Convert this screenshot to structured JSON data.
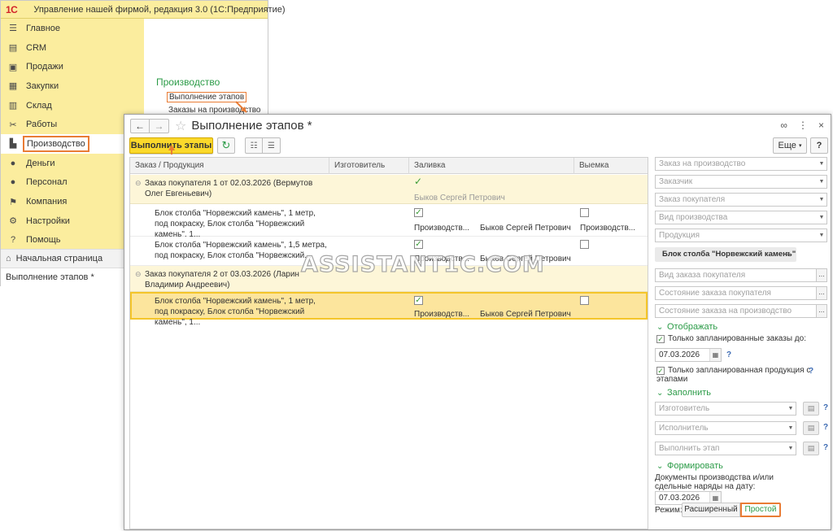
{
  "app": {
    "logo": "1С",
    "title": "Управление нашей фирмой, редакция 3.0  (1С:Предприятие)"
  },
  "sidebar": {
    "items": [
      {
        "label": "Главное",
        "icon": "menu-icon"
      },
      {
        "label": "CRM",
        "icon": "crm-icon"
      },
      {
        "label": "Продажи",
        "icon": "sales-icon"
      },
      {
        "label": "Закупки",
        "icon": "purchases-icon"
      },
      {
        "label": "Склад",
        "icon": "warehouse-icon"
      },
      {
        "label": "Работы",
        "icon": "works-icon"
      },
      {
        "label": "Производство",
        "icon": "factory-icon"
      },
      {
        "label": "Деньги",
        "icon": "money-icon"
      },
      {
        "label": "Персонал",
        "icon": "people-icon"
      },
      {
        "label": "Компания",
        "icon": "flag-icon"
      },
      {
        "label": "Настройки",
        "icon": "gear-icon"
      },
      {
        "label": "Помощь",
        "icon": "help-icon"
      }
    ],
    "active": "Производство"
  },
  "section": {
    "title": "Производство",
    "links": [
      "Выполнение этапов",
      "Заказы на производство"
    ]
  },
  "bottom": {
    "home": "Начальная страница",
    "open_window": "Выполнение этапов *"
  },
  "dialog": {
    "title": "Выполнение этапов *",
    "run_button": "Выполнить этапы",
    "more_button": "Еще",
    "help_button": "?"
  },
  "table": {
    "columns": [
      "Заказ / Продукция",
      "Изготовитель",
      "Заливка",
      "Выемка"
    ],
    "groups": [
      {
        "title": "Заказ покупателя 1 от 02.03.2026  (Вермутов Олег Евгеньевич)",
        "fill_done": true,
        "fill_performer": "Быков Сергей Петрович",
        "rows": [
          {
            "product": "Блок столба \"Норвежский камень\", 1 метр, под покраску, Блок столба \"Норвежский камень\", 1...",
            "fill_checked": true,
            "fill_maker": "Производств...",
            "fill_performer": "Быков Сергей Петрович",
            "cut_checked": false,
            "cut_maker": "Производств..."
          },
          {
            "product": "Блок столба \"Норвежский камень\", 1,5 метра, под покраску, Блок столба \"Норвежский...",
            "fill_checked": true,
            "fill_maker": "Производств...",
            "fill_performer": "Быков Сергей Петрович",
            "cut_checked": false,
            "cut_maker": ""
          }
        ]
      },
      {
        "title": "Заказ покупателя 2 от 03.03.2026  (Ларин Владимир Андреевич)",
        "rows": [
          {
            "product": "Блок столба \"Норвежский камень\", 1 метр, под покраску, Блок столба \"Норвежский камень\", 1...",
            "fill_checked": true,
            "fill_maker": "Производств...",
            "fill_performer": "Быков Сергей Петрович",
            "cut_checked": false,
            "cut_maker": ""
          }
        ]
      }
    ]
  },
  "filters": {
    "placeholders": [
      "Заказ на производство",
      "Заказчик",
      "Заказ покупателя",
      "Вид производства",
      "Продукция"
    ],
    "product_tag": "Блок столба \"Норвежский камень\"",
    "placeholders2": [
      "Вид заказа покупателя",
      "Состояние заказа покупателя",
      "Состояние заказа на производство"
    ],
    "display_section": "Отображать",
    "only_planned_orders": "Только запланированные заказы до:",
    "date1": "07.03.2026",
    "only_planned_products": "Только запланированная продукция с этапами",
    "fill_section": "Заполнить",
    "fill_fields": [
      "Изготовитель",
      "Исполнитель",
      "Выполнить этап"
    ],
    "form_section": "Формировать",
    "form_desc": "Документы производства и/или сдельные наряды на дату:",
    "date2": "07.03.2026",
    "mode_label": "Режим:",
    "mode_extended": "Расширенный",
    "mode_simple": "Простой",
    "help": "?"
  },
  "watermark": "ASSISTANT1C.COM",
  "colors": {
    "accent_yellow": "#fbed9e",
    "button_yellow": "#fbd92b",
    "green": "#2b9b47",
    "highlight_orange": "#e97c35"
  }
}
